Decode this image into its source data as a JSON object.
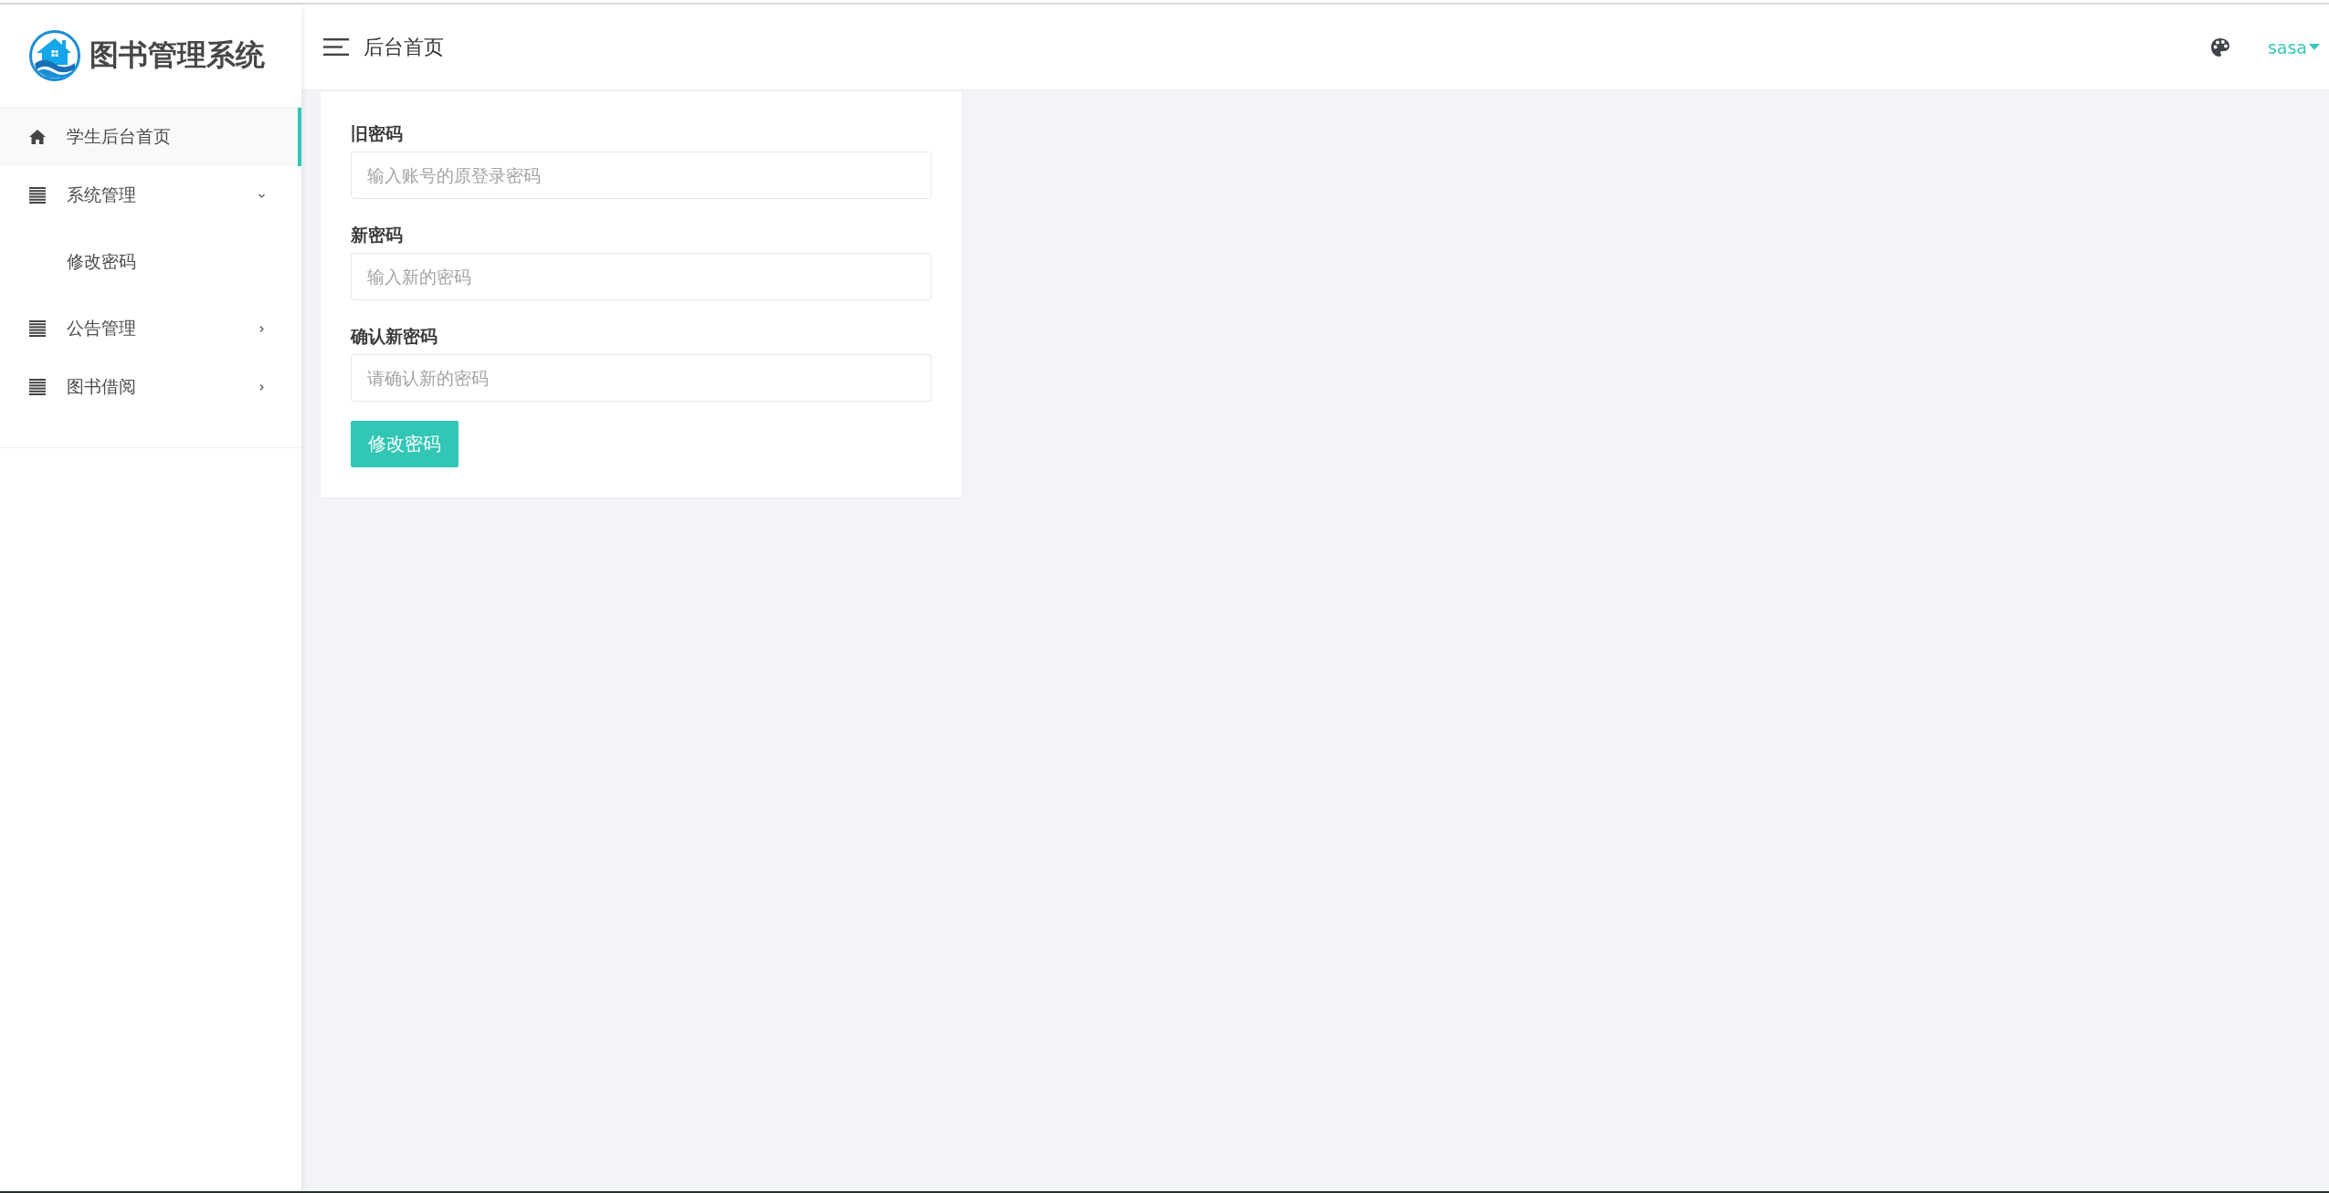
{
  "sidebar": {
    "app_title": "图书管理系统",
    "menu": [
      {
        "kind": "link",
        "label": "学生后台首页",
        "selected": true
      },
      {
        "kind": "group",
        "label": "系统管理",
        "selected": false,
        "expanded": true,
        "children": [
          {
            "label": "修改密码",
            "selected": false
          }
        ]
      },
      {
        "kind": "group",
        "label": "公告管理",
        "selected": false,
        "expanded": false
      },
      {
        "kind": "group",
        "label": "图书借阅",
        "selected": false,
        "expanded": false
      }
    ]
  },
  "header": {
    "title": "后台首页",
    "user": "sasa"
  },
  "form": {
    "fields": [
      {
        "label": "旧密码",
        "placeholder": "输入账号的原登录密码"
      },
      {
        "label": "新密码",
        "placeholder": "输入新的密码"
      },
      {
        "label": "确认新密码",
        "placeholder": "请确认新的密码"
      }
    ],
    "submit": "修改密码"
  }
}
